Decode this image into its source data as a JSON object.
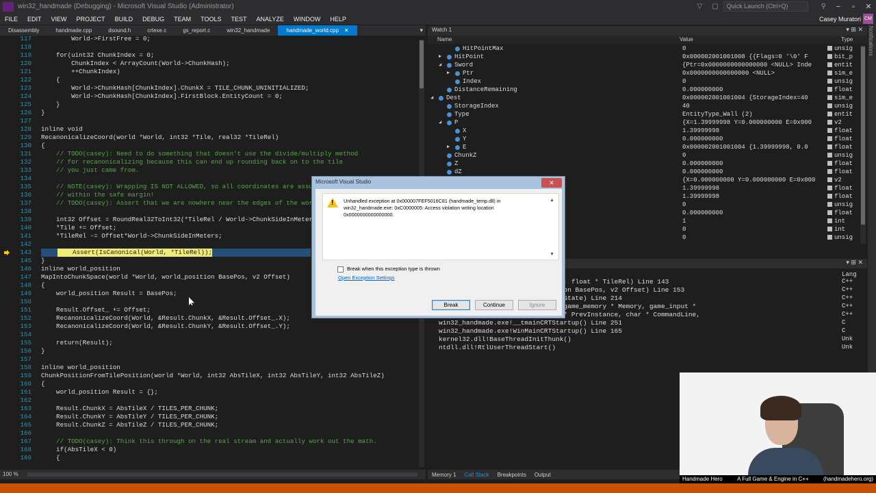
{
  "window": {
    "title": "win32_handmade (Debugging) - Microsoft Visual Studio (Administrator)",
    "quick_launch_placeholder": "Quick Launch (Ctrl+Q)",
    "minimize": "−",
    "maximize": "▫",
    "close": "✕"
  },
  "menu": {
    "items": [
      "FILE",
      "EDIT",
      "VIEW",
      "PROJECT",
      "BUILD",
      "DEBUG",
      "TEAM",
      "TOOLS",
      "TEST",
      "ANALYZE",
      "WINDOW",
      "HELP"
    ],
    "user": "Casey Muratori",
    "user_initials": "CM"
  },
  "notifications_label": "Notifications",
  "tabs": [
    "Disassembly",
    "handmade.cpp",
    "dsound.h",
    "crtexe.c",
    "gs_report.c",
    "win32_handmade",
    "handmade_world.cpp"
  ],
  "active_tab_close": "✕",
  "editor": {
    "zoom": "100 %",
    "lines": [
      {
        "n": "117",
        "t": "        World->FirstFree = 0;",
        "kind": "code"
      },
      {
        "n": "118",
        "t": "",
        "kind": "code"
      },
      {
        "n": "119",
        "t": "    for(uint32 ChunkIndex = 0;",
        "kind": "code"
      },
      {
        "n": "120",
        "t": "        ChunkIndex < ArrayCount(World->ChunkHash);",
        "kind": "code"
      },
      {
        "n": "121",
        "t": "        ++ChunkIndex)",
        "kind": "code"
      },
      {
        "n": "122",
        "t": "    {",
        "kind": "code"
      },
      {
        "n": "123",
        "t": "        World->ChunkHash[ChunkIndex].ChunkX = TILE_CHUNK_UNINITIALIZED;",
        "kind": "code"
      },
      {
        "n": "124",
        "t": "        World->ChunkHash[ChunkIndex].FirstBlock.EntityCount = 0;",
        "kind": "code"
      },
      {
        "n": "125",
        "t": "    }",
        "kind": "code"
      },
      {
        "n": "126",
        "t": "}",
        "kind": "code"
      },
      {
        "n": "127",
        "t": "",
        "kind": "code"
      },
      {
        "n": "128",
        "t": "inline void",
        "kind": "code"
      },
      {
        "n": "129",
        "t": "RecanonicalizeCoord(world *World, int32 *Tile, real32 *TileRel)",
        "kind": "code"
      },
      {
        "n": "130",
        "t": "{",
        "kind": "code"
      },
      {
        "n": "131",
        "t": "    // TODO(casey): Need to do something that doesn't use the divide/multiply method",
        "kind": "comment"
      },
      {
        "n": "132",
        "t": "    // for recanonicalizing because this can end up rounding back on to the tile",
        "kind": "comment"
      },
      {
        "n": "133",
        "t": "    // you just came from.",
        "kind": "comment"
      },
      {
        "n": "134",
        "t": "",
        "kind": "code"
      },
      {
        "n": "135",
        "t": "    // NOTE(casey): Wrapping IS NOT ALLOWED, so all coordinates are assumed to be",
        "kind": "comment"
      },
      {
        "n": "136",
        "t": "    // within the safe margin!",
        "kind": "comment"
      },
      {
        "n": "137",
        "t": "    // TODO(casey): Assert that we are nowhere near the edges of the world.",
        "kind": "comment"
      },
      {
        "n": "138",
        "t": "",
        "kind": "code"
      },
      {
        "n": "139",
        "t": "    int32 Offset = RoundReal32ToInt32(*TileRel / World->ChunkSideInMeters);",
        "kind": "code"
      },
      {
        "n": "140",
        "t": "    *Tile += Offset;",
        "kind": "code"
      },
      {
        "n": "141",
        "t": "    *TileRel -= Offset*World->ChunkSideInMeters;",
        "kind": "code"
      },
      {
        "n": "142",
        "t": "",
        "kind": "code"
      },
      {
        "n": "143",
        "t": "    Assert(IsCanonical(World, *TileRel));",
        "kind": "highlight"
      },
      {
        "n": "145",
        "t": "}",
        "kind": "code"
      },
      {
        "n": "146",
        "t": "inline world_position",
        "kind": "code"
      },
      {
        "n": "147",
        "t": "MapIntoChunkSpace(world *World, world_position BasePos, v2 Offset)",
        "kind": "code"
      },
      {
        "n": "148",
        "t": "{",
        "kind": "code"
      },
      {
        "n": "149",
        "t": "    world_position Result = BasePos;",
        "kind": "code"
      },
      {
        "n": "150",
        "t": "",
        "kind": "code"
      },
      {
        "n": "151",
        "t": "    Result.Offset_ += Offset;",
        "kind": "code"
      },
      {
        "n": "152",
        "t": "    RecanonicalizeCoord(World, &Result.ChunkX, &Result.Offset_.X);",
        "kind": "code"
      },
      {
        "n": "153",
        "t": "    RecanonicalizeCoord(World, &Result.ChunkY, &Result.Offset_.Y);",
        "kind": "code"
      },
      {
        "n": "154",
        "t": "",
        "kind": "code"
      },
      {
        "n": "155",
        "t": "    return(Result);",
        "kind": "code"
      },
      {
        "n": "156",
        "t": "}",
        "kind": "code"
      },
      {
        "n": "157",
        "t": "",
        "kind": "code"
      },
      {
        "n": "158",
        "t": "inline world_position",
        "kind": "code"
      },
      {
        "n": "159",
        "t": "ChunkPositionFromTilePosition(world *World, int32 AbsTileX, int32 AbsTileY, int32 AbsTileZ)",
        "kind": "code"
      },
      {
        "n": "160",
        "t": "{",
        "kind": "code"
      },
      {
        "n": "161",
        "t": "    world_position Result = {};",
        "kind": "code"
      },
      {
        "n": "162",
        "t": "",
        "kind": "code"
      },
      {
        "n": "163",
        "t": "    Result.ChunkX = AbsTileX / TILES_PER_CHUNK;",
        "kind": "code"
      },
      {
        "n": "164",
        "t": "    Result.ChunkY = AbsTileY / TILES_PER_CHUNK;",
        "kind": "code"
      },
      {
        "n": "165",
        "t": "    Result.ChunkZ = AbsTileZ / TILES_PER_CHUNK;",
        "kind": "code"
      },
      {
        "n": "166",
        "t": "",
        "kind": "code"
      },
      {
        "n": "167",
        "t": "    // TODO(casey): Think this through on the real stream and actually work out the math.",
        "kind": "comment"
      },
      {
        "n": "168",
        "t": "    if(AbsTileX < 0)",
        "kind": "code"
      },
      {
        "n": "169",
        "t": "    {",
        "kind": "code"
      }
    ]
  },
  "watch": {
    "title": "Watch 1",
    "col_name": "Name",
    "col_value": "Value",
    "col_type": "Type",
    "rows": [
      {
        "d": 2,
        "e": "",
        "n": "HitPointMax",
        "v": "0",
        "t": "unsig"
      },
      {
        "d": 1,
        "e": "▶",
        "n": "HitPoint",
        "v": "0x000002001001008 {{Flags=0 '\\0' F",
        "t": "bit_p"
      },
      {
        "d": 1,
        "e": "◢",
        "n": "Sword",
        "v": "{Ptr=0x0000000000000000 <NULL> Inde",
        "t": "entit"
      },
      {
        "d": 2,
        "e": "▶",
        "n": "Ptr",
        "v": "0x0000000000000000 <NULL>",
        "t": "sim_e"
      },
      {
        "d": 2,
        "e": "",
        "n": "Index",
        "v": "0",
        "t": "unsig"
      },
      {
        "d": 1,
        "e": "",
        "n": "DistanceRemaining",
        "v": "0.000000000",
        "t": "float"
      },
      {
        "d": 0,
        "e": "◢",
        "n": "Dest",
        "v": "0x000002001001004 {StorageIndex=40",
        "t": "sim_e"
      },
      {
        "d": 1,
        "e": "",
        "n": "StorageIndex",
        "v": "40",
        "t": "unsig"
      },
      {
        "d": 1,
        "e": "",
        "n": "Type",
        "v": "EntityType_Wall (2)",
        "t": "entit"
      },
      {
        "d": 1,
        "e": "◢",
        "n": "P",
        "v": "{X=1.39999998 Y=0.000000000 E=0x000",
        "t": "v2"
      },
      {
        "d": 2,
        "e": "",
        "n": "X",
        "v": "1.39999998",
        "t": "float"
      },
      {
        "d": 2,
        "e": "",
        "n": "Y",
        "v": "0.000000000",
        "t": "float"
      },
      {
        "d": 2,
        "e": "▶",
        "n": "E",
        "v": "0x000002001001004 {1.39999998, 0.0",
        "t": "float"
      },
      {
        "d": 1,
        "e": "",
        "n": "ChunkZ",
        "v": "0",
        "t": "unsig"
      },
      {
        "d": 1,
        "e": "",
        "n": "Z",
        "v": "0.000000000",
        "t": "float"
      },
      {
        "d": 1,
        "e": "",
        "n": "dZ",
        "v": "0.000000000",
        "t": "float"
      },
      {
        "d": 1,
        "e": "",
        "n": "",
        "v": "{X=0.000000000 Y=0.000000000 E=0x000",
        "t": "v2"
      },
      {
        "d": 1,
        "e": "",
        "n": "",
        "v": "1.39999998",
        "t": "float"
      },
      {
        "d": 1,
        "e": "",
        "n": "",
        "v": "1.39999998",
        "t": "float"
      },
      {
        "d": 1,
        "e": "",
        "n": "",
        "v": "0",
        "t": "unsig"
      },
      {
        "d": 1,
        "e": "",
        "n": "",
        "v": "0.000000000",
        "t": "float"
      },
      {
        "d": 1,
        "e": "",
        "n": "",
        "v": "1",
        "t": "int"
      },
      {
        "d": 1,
        "e": "",
        "n": "",
        "v": "0",
        "t": "int"
      },
      {
        "d": 1,
        "e": "",
        "n": "",
        "v": "0",
        "t": "unsig"
      }
    ]
  },
  "callstack": {
    "lang_header": "Lang",
    "rows": [
      {
        "t": "              eCoord(world * World, int * Tile, float * TileRel) Line 143",
        "l": "C++"
      },
      {
        "t": "              pace(world * World, world_position BasePos, v2 Offset) Line 153",
        "l": "C++"
      },
      {
        "t": "              gion * Region, game_state * GameState) Line 214",
        "l": "C++"
      },
      {
        "t": "              Render(thread_context * Thread, game_memory * Memory, game_input *",
        "l": "C++"
      },
      {
        "t": "              TANCE__ * Instance, HINSTANCE__ * PrevInstance, char * CommandLine,",
        "l": "C++"
      },
      {
        "t": "win32_handmade.exe!__tmainCRTStartup() Line 251",
        "l": "C"
      },
      {
        "t": "win32_handmade.exe!WinMainCRTStartup() Line 165",
        "l": "C"
      },
      {
        "t": "kernel32.dll!BaseThreadInitThunk()",
        "l": "Unk"
      },
      {
        "t": "ntdll.dll!RtlUserThreadStart()",
        "l": "Unk"
      }
    ]
  },
  "bottom_tabs": [
    "Memory 1",
    "Call Stack",
    "Breakpoints",
    "Output"
  ],
  "dialog": {
    "title": "Microsoft Visual Studio",
    "message": "Unhandled exception at 0x000007FEF5016C81 (handmade_temp.dll) in win32_handmade.exe: 0xC0000005: Access violation writing location 0x0000000000000000.",
    "checkbox_label": "Break when this exception type is thrown",
    "link": "Open Exception Settings",
    "break_label": "Break",
    "continue_label": "Continue",
    "ignore_label": "Ignore",
    "close": "✕"
  },
  "webcam": {
    "caption_left": "Handmade Hero",
    "caption_mid": "A Full Game & Engine in C++",
    "caption_right": "(handmadehero.org)"
  }
}
